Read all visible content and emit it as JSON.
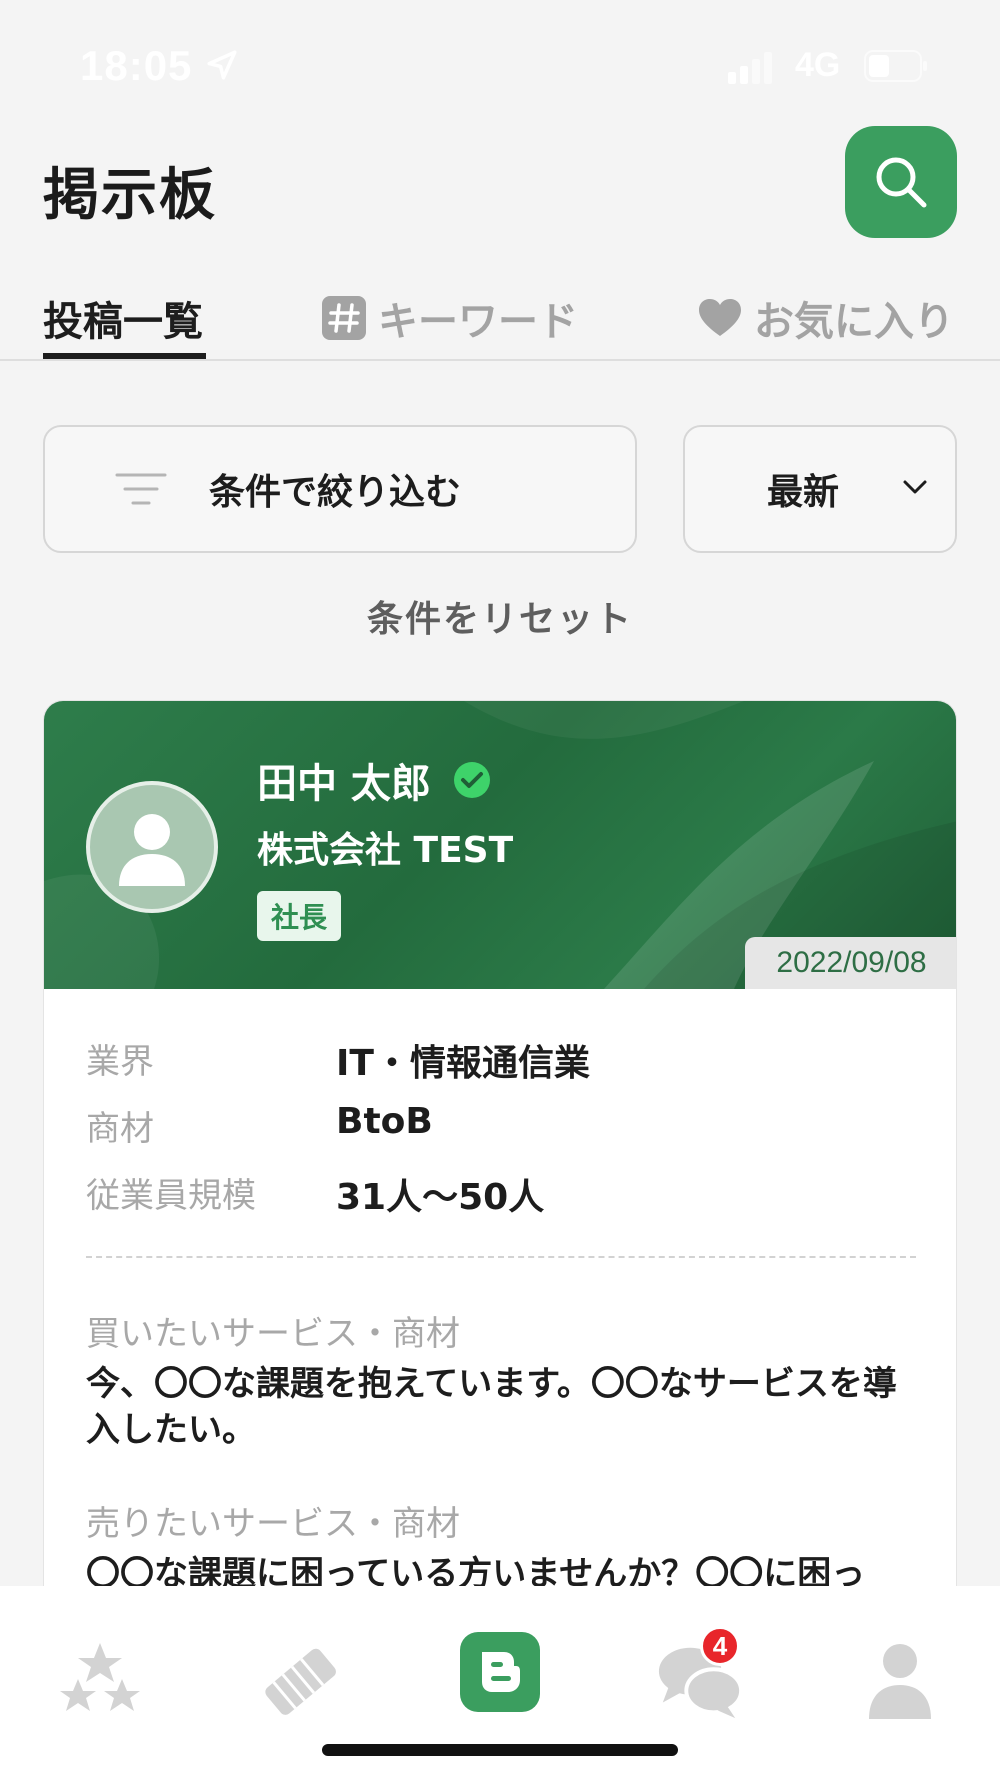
{
  "status_bar": {
    "time": "18:05",
    "network": "4G"
  },
  "header": {
    "title": "掲示板"
  },
  "tabs": [
    {
      "label": "投稿一覧",
      "active": true
    },
    {
      "label": "キーワード",
      "icon": "hash-icon"
    },
    {
      "label": "お気に入り",
      "icon": "heart-icon"
    }
  ],
  "filter": {
    "label": "条件で絞り込む",
    "icon": "filter-icon"
  },
  "sort": {
    "selected": "最新"
  },
  "reset_label": "条件をリセット",
  "post": {
    "user_name": "田中 太郎",
    "verified": true,
    "company": "株式会社 TEST",
    "role": "社長",
    "date": "2022/09/08",
    "details": [
      {
        "key": "業界",
        "value": "IT・情報通信業"
      },
      {
        "key": "商材",
        "value": "BtoB"
      },
      {
        "key": "従業員規模",
        "value": "31人〜50人"
      }
    ],
    "buy_label": "買いたいサービス・商材",
    "buy_text": "今、〇〇な課題を抱えています。〇〇なサービスを導入したい。",
    "sell_label": "売りたいサービス・商材",
    "sell_text": "〇〇な課題に困っている方いませんか？〇〇に困っ"
  },
  "bottom_nav": {
    "items": [
      "stars-icon",
      "handshake-icon",
      "board-icon",
      "chat-icon",
      "profile-icon"
    ],
    "chat_badge": "4"
  },
  "colors": {
    "brand_green": "#3b9e5f",
    "header_green": "#236b3d",
    "badge_red": "#e8262b"
  }
}
